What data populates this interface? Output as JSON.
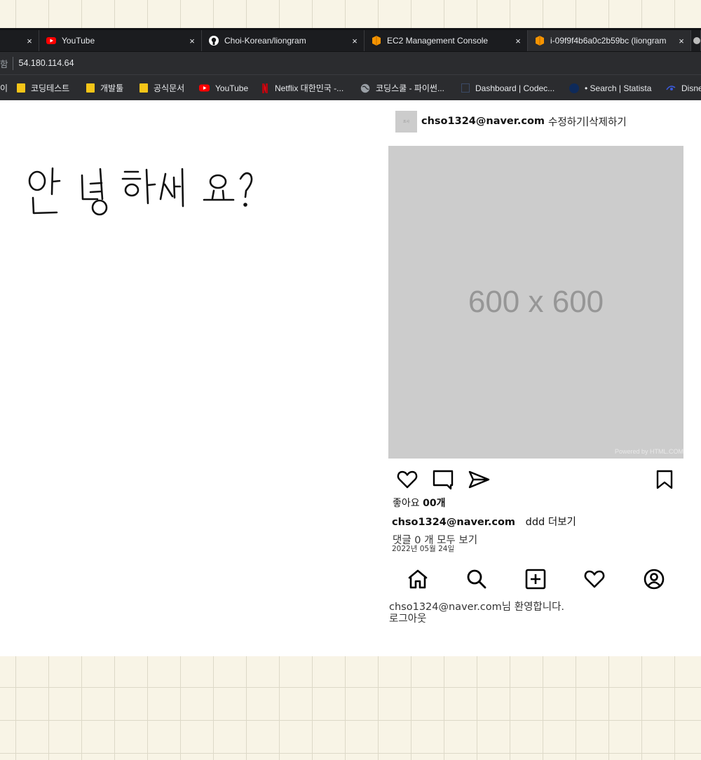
{
  "browser": {
    "tabs": [
      {
        "title": "",
        "icon": "tab-icon"
      },
      {
        "title": "YouTube",
        "icon": "youtube-icon"
      },
      {
        "title": "Choi-Korean/liongram",
        "icon": "github-icon"
      },
      {
        "title": "EC2 Management Console",
        "icon": "aws-icon"
      },
      {
        "title": "i-09f9f4b6a0c2b59bc (liongram",
        "icon": "aws-icon"
      }
    ],
    "address": {
      "security_text": "함",
      "url": "54.180.114.64"
    },
    "bookmarks": [
      {
        "label": "이",
        "icon": "folder-icon"
      },
      {
        "label": "코딩테스트",
        "icon": "folder-icon"
      },
      {
        "label": "개발툴",
        "icon": "folder-icon"
      },
      {
        "label": "공식문서",
        "icon": "folder-icon"
      },
      {
        "label": "YouTube",
        "icon": "youtube-icon"
      },
      {
        "label": "Netflix 대한민국 -...",
        "icon": "netflix-icon"
      },
      {
        "label": "코딩스쿨 - 파이썬...",
        "icon": "globe-icon"
      },
      {
        "label": "Dashboard | Codec...",
        "icon": "codecov-icon"
      },
      {
        "label": "• Search | Statista",
        "icon": "statista-icon"
      },
      {
        "label": "Disne",
        "icon": "disney-icon"
      }
    ]
  },
  "page": {
    "handwritten_greeting": "안녕하세요 ?",
    "post": {
      "author_avatar_alt": "프사",
      "author": "chso1324@naver.com",
      "edit_label": "수정하기",
      "separator": "|",
      "delete_label": "삭제하기",
      "image_placeholder_text": "600 x 600",
      "image_powered_by": "Powered by HTML.COM",
      "likes_label": "좋아요 ",
      "likes_count": "00개",
      "caption_author": "chso1324@naver.com",
      "caption_text": "ddd",
      "more_label": "더보기",
      "comments_label": "댓글 0 개 모두 보기",
      "date": "2022년 05월 24일"
    },
    "bottom_nav": [
      "home-icon",
      "search-icon",
      "add-post-icon",
      "activity-heart-icon",
      "profile-icon"
    ],
    "footer": {
      "welcome_text": "chso1324@naver.com님 환영합니다.",
      "logout_label": "로그아웃"
    }
  },
  "colors": {
    "tabbar": "#111214",
    "toolbar": "#2b2c2f",
    "image_placeholder": "#cccccc",
    "paper": "#f8f4e6",
    "grid": "#ddd9c8"
  }
}
